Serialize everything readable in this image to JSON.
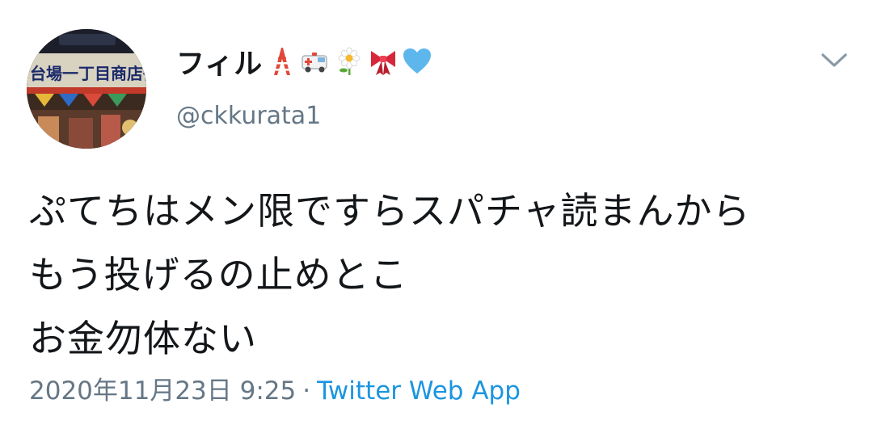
{
  "user": {
    "display_name": "フィル",
    "handle": "@ckkurata1",
    "name_emojis": [
      "tokyo-tower",
      "ambulance",
      "daisy",
      "ribbon",
      "blue-heart"
    ],
    "avatar_sign_text": "台場一丁目商店街"
  },
  "tweet": {
    "lines": [
      "ぷてちはメン限ですらスパチャ読まんから",
      "もう投げるの止めとこ",
      "お金勿体ない"
    ],
    "timestamp": "2020年11月23日 9:25",
    "separator": "·",
    "source": "Twitter Web App"
  },
  "colors": {
    "text": "#14171a",
    "secondary": "#657786",
    "link": "#1b95e0"
  },
  "icons": {
    "menu": "chevron-down-icon"
  }
}
